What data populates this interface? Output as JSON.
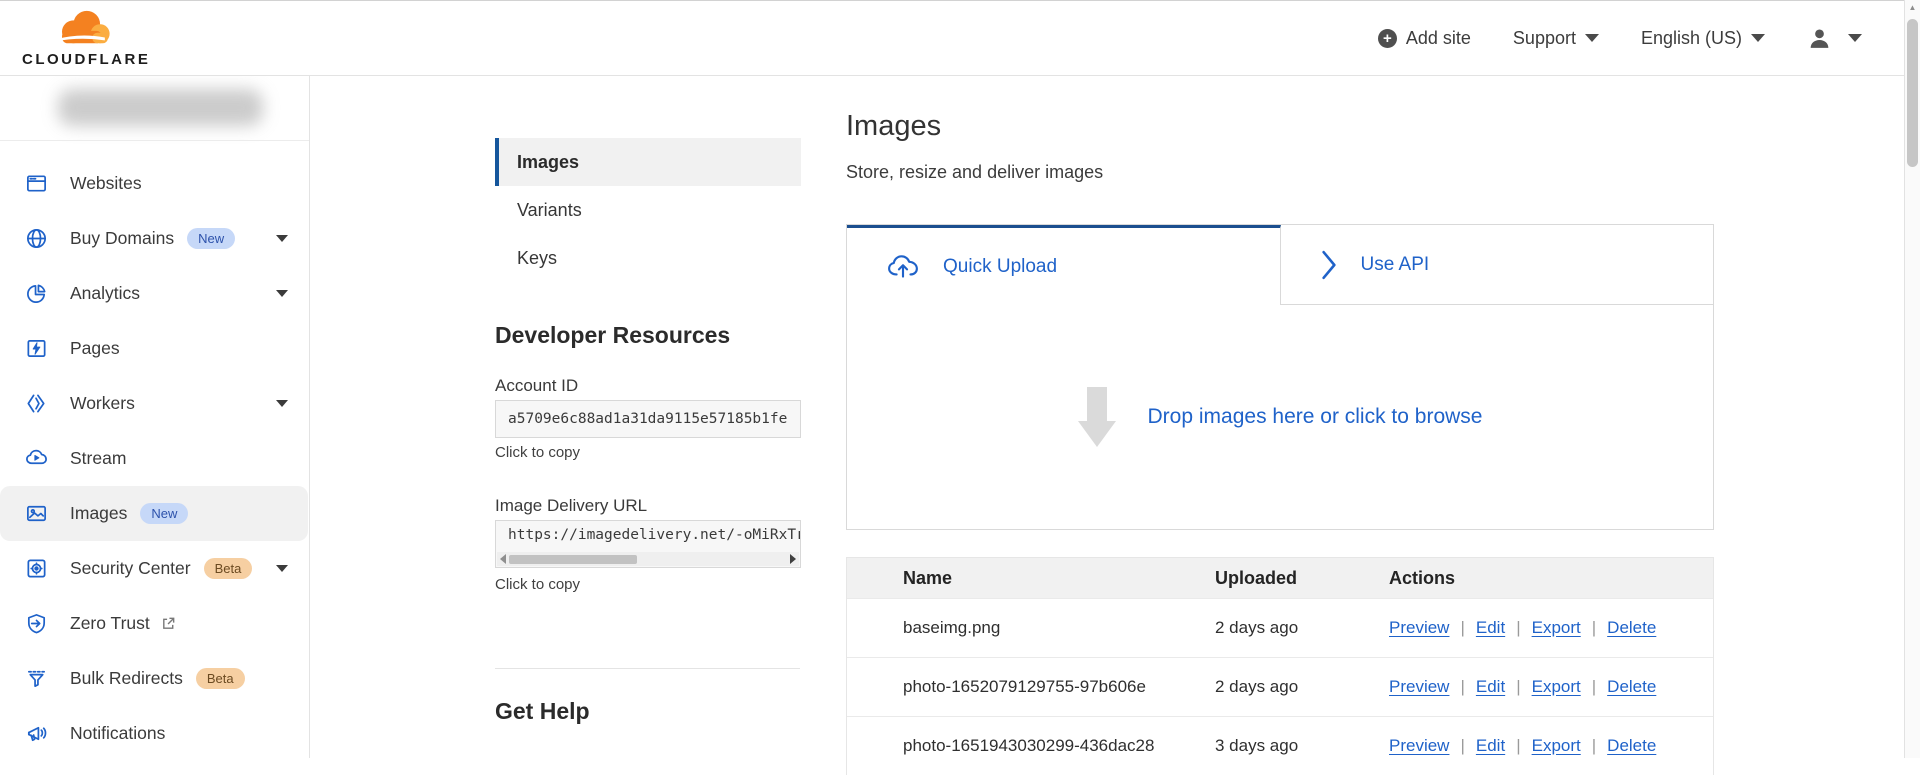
{
  "header": {
    "logo_text": "CLOUDFLARE",
    "add_site_label": "Add site",
    "support_label": "Support",
    "language_label": "English (US)"
  },
  "sidebar": {
    "items": [
      {
        "label": "Websites",
        "icon": "browser-window-icon"
      },
      {
        "label": "Buy Domains",
        "icon": "globe-icon",
        "badge": "New",
        "badge_style": "new",
        "caret": true
      },
      {
        "label": "Analytics",
        "icon": "pie-chart-icon",
        "caret": true
      },
      {
        "label": "Pages",
        "icon": "pages-icon"
      },
      {
        "label": "Workers",
        "icon": "workers-icon",
        "caret": true
      },
      {
        "label": "Stream",
        "icon": "stream-icon"
      },
      {
        "label": "Images",
        "icon": "images-icon",
        "badge": "New",
        "badge_style": "new",
        "selected": true
      },
      {
        "label": "Security Center",
        "icon": "security-center-icon",
        "badge": "Beta",
        "badge_style": "beta",
        "caret": true
      },
      {
        "label": "Zero Trust",
        "icon": "zero-trust-icon",
        "external": true
      },
      {
        "label": "Bulk Redirects",
        "icon": "funnel-icon",
        "badge": "Beta",
        "badge_style": "beta"
      },
      {
        "label": "Notifications",
        "icon": "megaphone-icon"
      }
    ]
  },
  "subnav": {
    "items": [
      {
        "label": "Images",
        "selected": true
      },
      {
        "label": "Variants"
      },
      {
        "label": "Keys"
      }
    ],
    "developer_resources_title": "Developer Resources",
    "account_id_label": "Account ID",
    "account_id_value": "a5709e6c88ad1a31da9115e57185b1fe",
    "click_to_copy": "Click to copy",
    "delivery_url_label": "Image Delivery URL",
    "delivery_url_value": "https://imagedelivery.net/-oMiRxTr",
    "get_help_title": "Get Help"
  },
  "main": {
    "title": "Images",
    "subtitle": "Store, resize and deliver images",
    "tabs": [
      {
        "label": "Quick Upload",
        "icon": "cloud-upload-icon",
        "active": true
      },
      {
        "label": "Use API",
        "icon": "chevron-right-icon",
        "active": false
      }
    ],
    "dropzone_text": "Drop images here or click to browse",
    "table": {
      "columns": [
        "Name",
        "Uploaded",
        "Actions"
      ],
      "actions": [
        "Preview",
        "Edit",
        "Export",
        "Delete"
      ],
      "separator": "|",
      "rows": [
        {
          "name": "baseimg.png",
          "uploaded": "2 days ago"
        },
        {
          "name": "photo-1652079129755-97b606e",
          "uploaded": "2 days ago"
        },
        {
          "name": "photo-1651943030299-436dac28",
          "uploaded": "3 days ago"
        }
      ]
    }
  },
  "colors": {
    "link_blue": "#1f62c9",
    "accent_dark_blue": "#1b4f8f",
    "brand_orange": "#f48120",
    "brand_orange_light": "#fbad41",
    "badge_new_bg": "#c6d8f8",
    "badge_new_text": "#2d52ab",
    "badge_beta_bg": "#f6cfa2",
    "badge_beta_text": "#6b4a21",
    "selected_bg": "#f1f1f1"
  }
}
